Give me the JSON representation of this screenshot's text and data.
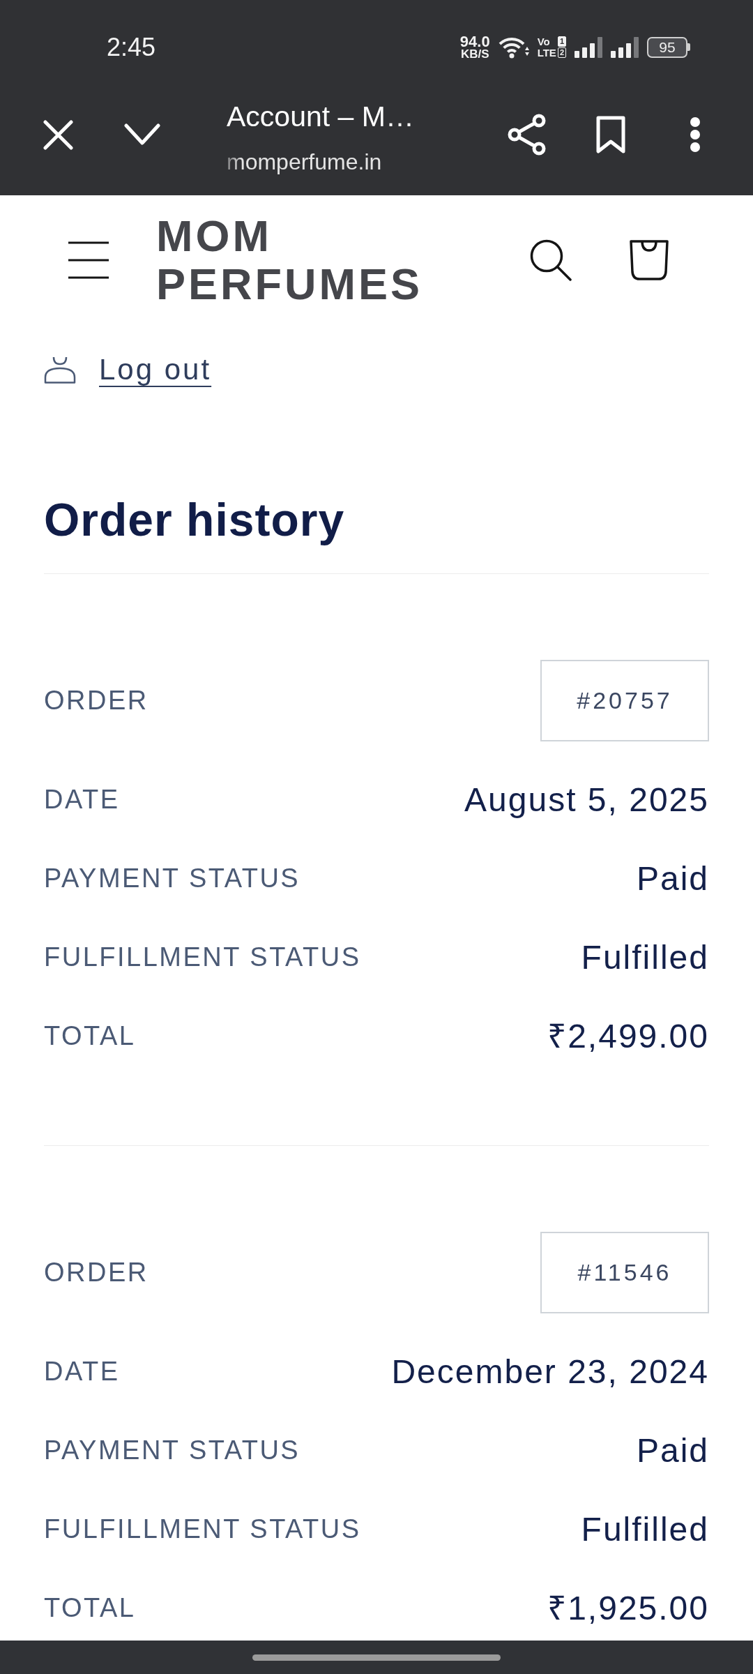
{
  "status_bar": {
    "time": "2:45",
    "net_speed": {
      "value": "94.0",
      "unit": "KB/S"
    },
    "volte": {
      "line_1": "Vo",
      "sim_1": "1",
      "line_2": "LTE",
      "sim_2": "2"
    },
    "battery": "95"
  },
  "browser_bar": {
    "title": "Account – M…",
    "url": "momperfume.in"
  },
  "header": {
    "logo": "MOM PERFUMES"
  },
  "account": {
    "logout": "Log out"
  },
  "order_history": {
    "title": "Order history"
  },
  "orders": [
    {
      "fields": [
        {
          "kind": "badge",
          "label": "ORDER",
          "value": "#20757"
        },
        {
          "kind": "text",
          "label": "DATE",
          "value": "August 5, 2025"
        },
        {
          "kind": "text",
          "label": "PAYMENT STATUS",
          "value": "Paid"
        },
        {
          "kind": "text",
          "label": "FULFILLMENT STATUS",
          "value": "Fulfilled"
        },
        {
          "kind": "text",
          "label": "TOTAL",
          "value": "₹2,499.00"
        }
      ]
    },
    {
      "fields": [
        {
          "kind": "badge",
          "label": "ORDER",
          "value": "#11546"
        },
        {
          "kind": "text",
          "label": "DATE",
          "value": "December 23, 2024"
        },
        {
          "kind": "text",
          "label": "PAYMENT STATUS",
          "value": "Paid"
        },
        {
          "kind": "text",
          "label": "FULFILLMENT STATUS",
          "value": "Fulfilled"
        },
        {
          "kind": "text",
          "label": "TOTAL",
          "value": "₹1,925.00"
        }
      ]
    }
  ]
}
